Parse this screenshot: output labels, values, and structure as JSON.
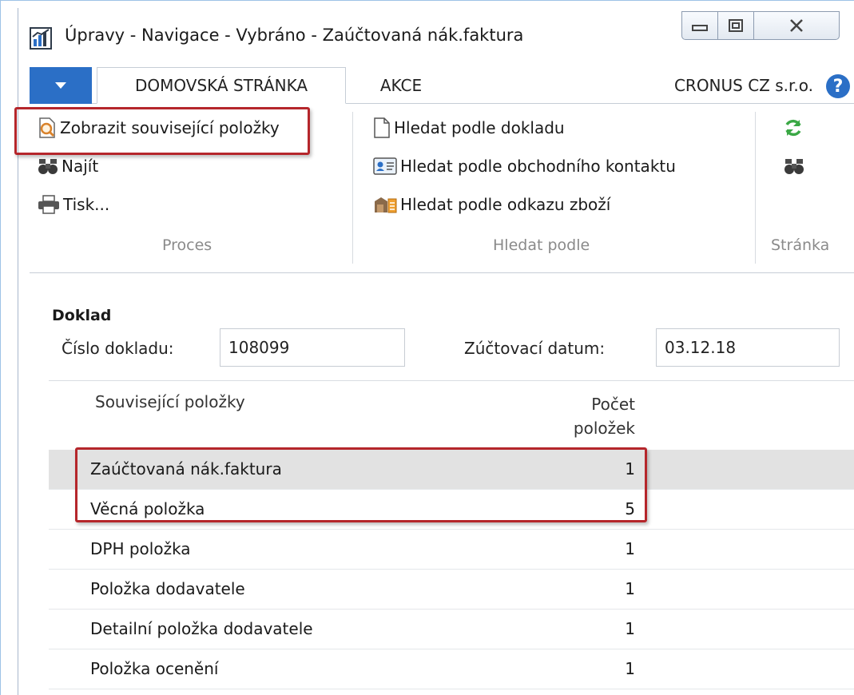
{
  "window": {
    "title": "Úpravy - Navigace - Vybráno - Zaúčtovaná nák.faktura",
    "icon": "app-chart-icon"
  },
  "ribbon": {
    "tabs": [
      {
        "label": "DOMOVSKÁ STRÁNKA",
        "active": true
      },
      {
        "label": "AKCE",
        "active": false
      }
    ],
    "company": "CRONUS CZ s.r.o.",
    "groups": {
      "proces": {
        "label": "Proces",
        "items": [
          {
            "label": "Zobrazit související položky",
            "icon": "show-related-icon"
          },
          {
            "label": "Najít",
            "icon": "binoculars-icon"
          },
          {
            "label": "Tisk...",
            "icon": "printer-icon"
          }
        ]
      },
      "hledat": {
        "label": "Hledat podle",
        "items": [
          {
            "label": "Hledat podle dokladu",
            "icon": "document-icon"
          },
          {
            "label": "Hledat podle obchodního kontaktu",
            "icon": "contact-card-icon"
          },
          {
            "label": "Hledat podle odkazu zboží",
            "icon": "item-reference-icon"
          }
        ]
      },
      "stranka": {
        "label": "Stránka",
        "items": [
          {
            "icon": "refresh-icon"
          },
          {
            "icon": "binoculars-icon"
          }
        ]
      }
    }
  },
  "doklad": {
    "section_title": "Doklad",
    "cislo_label": "Číslo dokladu:",
    "cislo_value": "108099",
    "datum_label": "Zúčtovací datum:",
    "datum_value": "03.12.18"
  },
  "grid": {
    "header_name": "Související položky",
    "header_count_line1": "Počet",
    "header_count_line2": "položek",
    "rows": [
      {
        "name": "Zaúčtovaná nák.faktura",
        "count": "1"
      },
      {
        "name": "Věcná položka",
        "count": "5"
      },
      {
        "name": "DPH položka",
        "count": "1"
      },
      {
        "name": "Položka dodavatele",
        "count": "1"
      },
      {
        "name": "Detailní položka dodavatele",
        "count": "1"
      },
      {
        "name": "Položka ocenění",
        "count": "1"
      }
    ]
  },
  "colors": {
    "accent": "#2b6fc6",
    "highlight": "#b5262b",
    "selected_row": "#e2e2e2"
  }
}
